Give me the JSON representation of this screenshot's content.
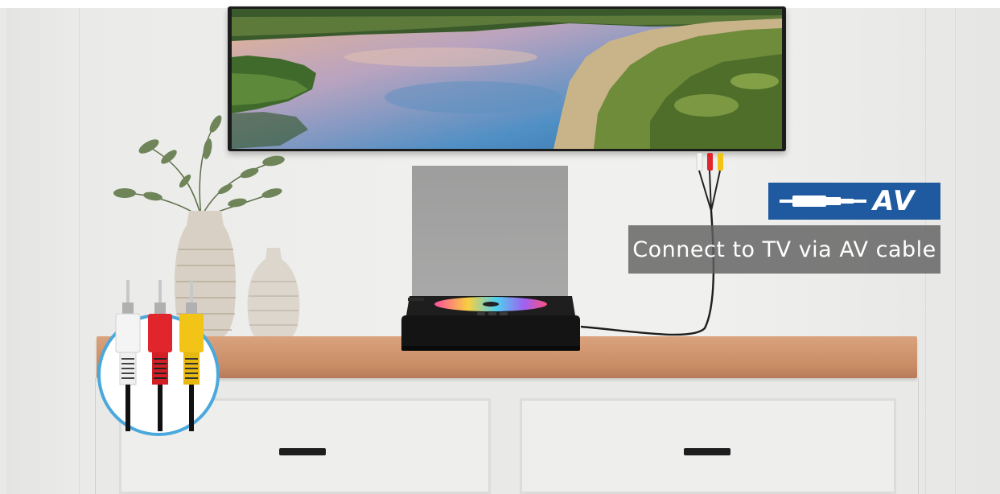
{
  "badge": {
    "label": "AV",
    "color": "#1f5aa0",
    "icon": "av-cable-plug-icon"
  },
  "caption": {
    "text": "Connect to TV via AV cable"
  },
  "colors": {
    "cable_white": "#f4f4f4",
    "cable_red": "#e0262c",
    "cable_yellow": "#f2c418",
    "inset_border": "#4aa8dc",
    "cabinet_top": "#c98d66"
  }
}
